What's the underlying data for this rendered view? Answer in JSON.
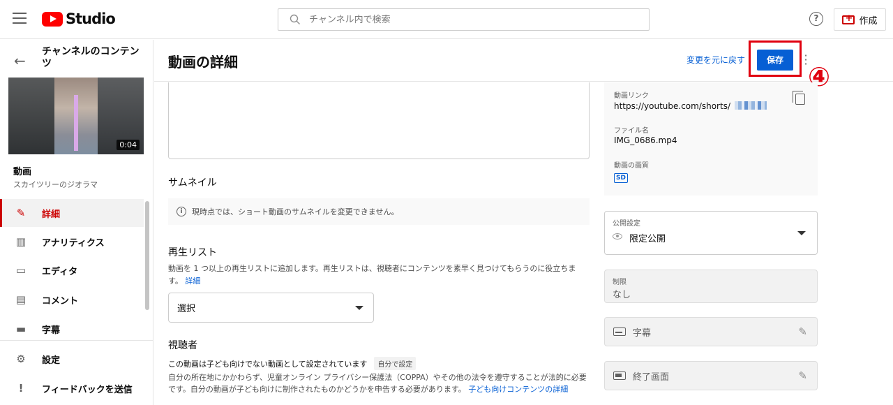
{
  "topbar": {
    "logo_text": "Studio",
    "search_placeholder": "チャンネル内で検索",
    "help_label": "?",
    "create_label": "作成"
  },
  "sidebar": {
    "title": "チャンネルのコンテンツ",
    "thumbnail_duration": "0:04",
    "video_label": "動画",
    "video_name": "スカイツリーのジオラマ",
    "items": [
      {
        "label": "詳細",
        "icon": "pencil-icon",
        "active": true
      },
      {
        "label": "アナリティクス",
        "icon": "analytics-icon",
        "active": false
      },
      {
        "label": "エディタ",
        "icon": "editor-icon",
        "active": false
      },
      {
        "label": "コメント",
        "icon": "comment-icon",
        "active": false
      },
      {
        "label": "字幕",
        "icon": "subtitles-icon",
        "active": false
      },
      {
        "label": "設定",
        "icon": "gear-icon",
        "active": false
      },
      {
        "label": "フィードバックを送信",
        "icon": "feedback-icon",
        "active": false
      }
    ]
  },
  "header": {
    "title": "動画の詳細",
    "undo_label": "変更を元に戻す",
    "save_label": "保存",
    "annotation": "④"
  },
  "main": {
    "thumbnail_heading": "サムネイル",
    "thumbnail_info": "現時点では、ショート動画のサムネイルを変更できません。",
    "playlist_heading": "再生リスト",
    "playlist_desc": "動画を 1 つ以上の再生リストに追加します。再生リストは、視聴者にコンテンツを素早く見つけてもらうのに役立ちます。",
    "playlist_link": "詳細",
    "playlist_select": "選択",
    "audience_heading": "視聴者",
    "audience_status": "この動画は子ども向けでない動画として設定されています",
    "audience_badge": "自分で設定",
    "audience_desc": "自分の所在地にかかわらず、児童オンライン プライバシー保護法（COPPA）やその他の法令を遵守することが法的に必要です。自分の動画が子ども向けに制作されたものかどうかを申告する必要があります。",
    "audience_link": "子ども向けコンテンツの詳細"
  },
  "right": {
    "video_link_label": "動画リンク",
    "video_link_value": "https://youtube.com/shorts/",
    "filename_label": "ファイル名",
    "filename_value": "IMG_0686.mp4",
    "quality_label": "動画の画質",
    "quality_badge": "SD",
    "visibility_label": "公開設定",
    "visibility_value": "限定公開",
    "restriction_label": "制限",
    "restriction_value": "なし",
    "subtitles_label": "字幕",
    "endscreen_label": "終了画面"
  },
  "colors": {
    "brand_red": "#ff0000",
    "accent_blue": "#065fd4",
    "annotation_red": "#e0000f"
  }
}
